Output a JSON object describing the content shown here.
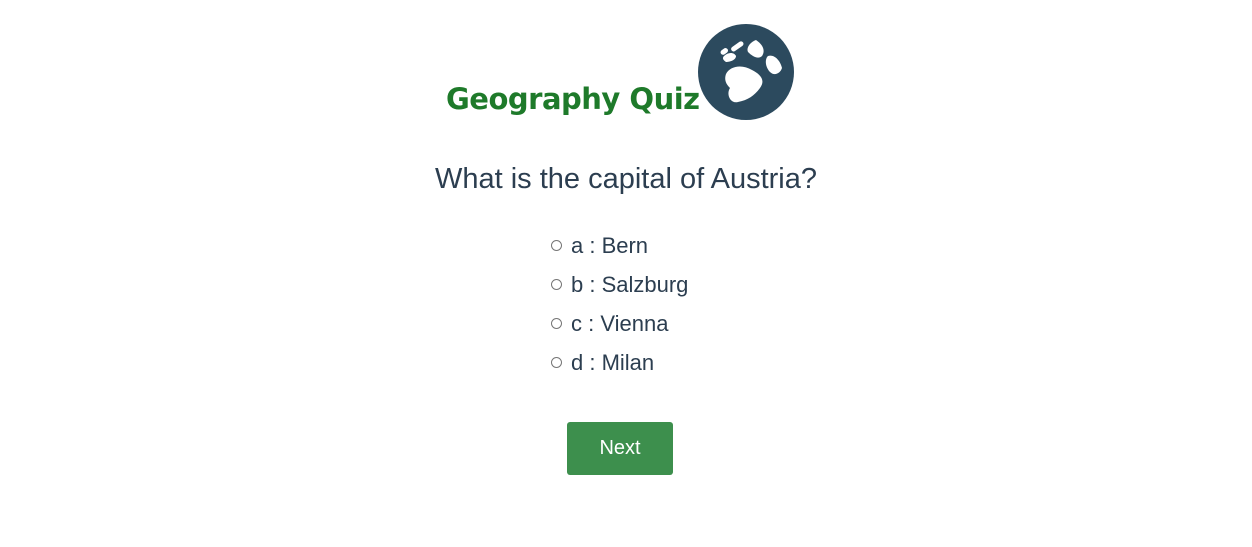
{
  "header": {
    "title": "Geography Quiz",
    "logo_icon": "globe-icon",
    "title_color": "#1e7a2a",
    "logo_color": "#2c4a5e"
  },
  "quiz": {
    "question": "What is the capital of Austria?",
    "options": [
      {
        "text": "a : Bern"
      },
      {
        "text": "b : Salzburg"
      },
      {
        "text": "c : Vienna"
      },
      {
        "text": "d : Milan"
      }
    ],
    "next_label": "Next",
    "button_color": "#3d8f4d"
  }
}
